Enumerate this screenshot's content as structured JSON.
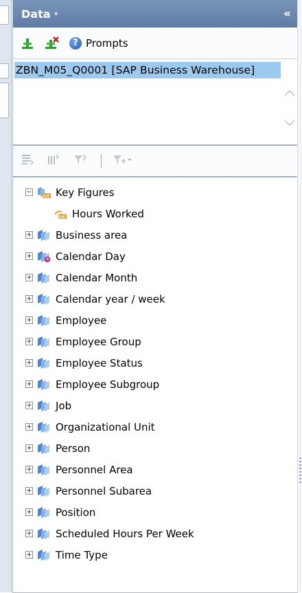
{
  "panel": {
    "title": "Data",
    "title_caret": "▾",
    "collapse_glyph": "«"
  },
  "toolbar": {
    "prompts_label": "Prompts"
  },
  "query": {
    "name": "ZBN_M05_Q0001 [SAP Business Warehouse]"
  },
  "tree": {
    "key_figures": {
      "label": "Key Figures",
      "expander": "−",
      "children": [
        "Hours Worked"
      ]
    },
    "dimensions": [
      {
        "label": "Business area",
        "icon": "dimension-icon"
      },
      {
        "label": "Calendar Day",
        "icon": "time-dimension-icon"
      },
      {
        "label": "Calendar Month",
        "icon": "dimension-icon"
      },
      {
        "label": "Calendar year / week",
        "icon": "dimension-icon"
      },
      {
        "label": "Employee",
        "icon": "dimension-icon"
      },
      {
        "label": "Employee Group",
        "icon": "dimension-icon"
      },
      {
        "label": "Employee Status",
        "icon": "dimension-icon"
      },
      {
        "label": "Employee Subgroup",
        "icon": "dimension-icon"
      },
      {
        "label": "Job",
        "icon": "dimension-icon"
      },
      {
        "label": "Organizational Unit",
        "icon": "dimension-icon"
      },
      {
        "label": "Person",
        "icon": "dimension-icon"
      },
      {
        "label": "Personnel Area",
        "icon": "dimension-icon"
      },
      {
        "label": "Personnel Subarea",
        "icon": "dimension-icon"
      },
      {
        "label": "Position",
        "icon": "dimension-icon"
      },
      {
        "label": "Scheduled Hours Per Week",
        "icon": "dimension-icon"
      },
      {
        "label": "Time Type",
        "icon": "dimension-icon"
      }
    ],
    "expand_glyph": "+"
  },
  "colors": {
    "header": "#6b87b0",
    "selection": "#9cc9ee",
    "dimension_icon": "#5b8fd6",
    "key_figure_icon": "#f0a020"
  }
}
